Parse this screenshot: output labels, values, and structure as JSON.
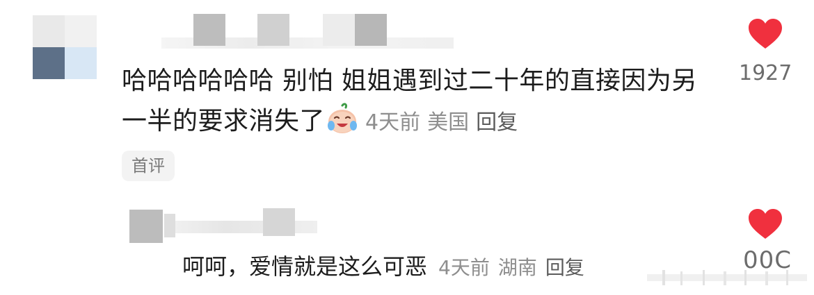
{
  "comment": {
    "text": "哈哈哈哈哈哈 别怕 姐姐遇到过二十年的直接因为另一半的要求消失了",
    "emoji_icon": "crying-laughing-emoji-icon",
    "time": "4天前",
    "location": "美国",
    "reply_label": "回复",
    "badge": "首评",
    "likes": "1927",
    "heart_color": "#f0303e"
  },
  "reply": {
    "text": "呵呵，爱情就是这么可恶",
    "time": "4天前",
    "location": "湖南",
    "reply_label": "回复",
    "likes_visible": "00C",
    "heart_color": "#f0303e"
  }
}
